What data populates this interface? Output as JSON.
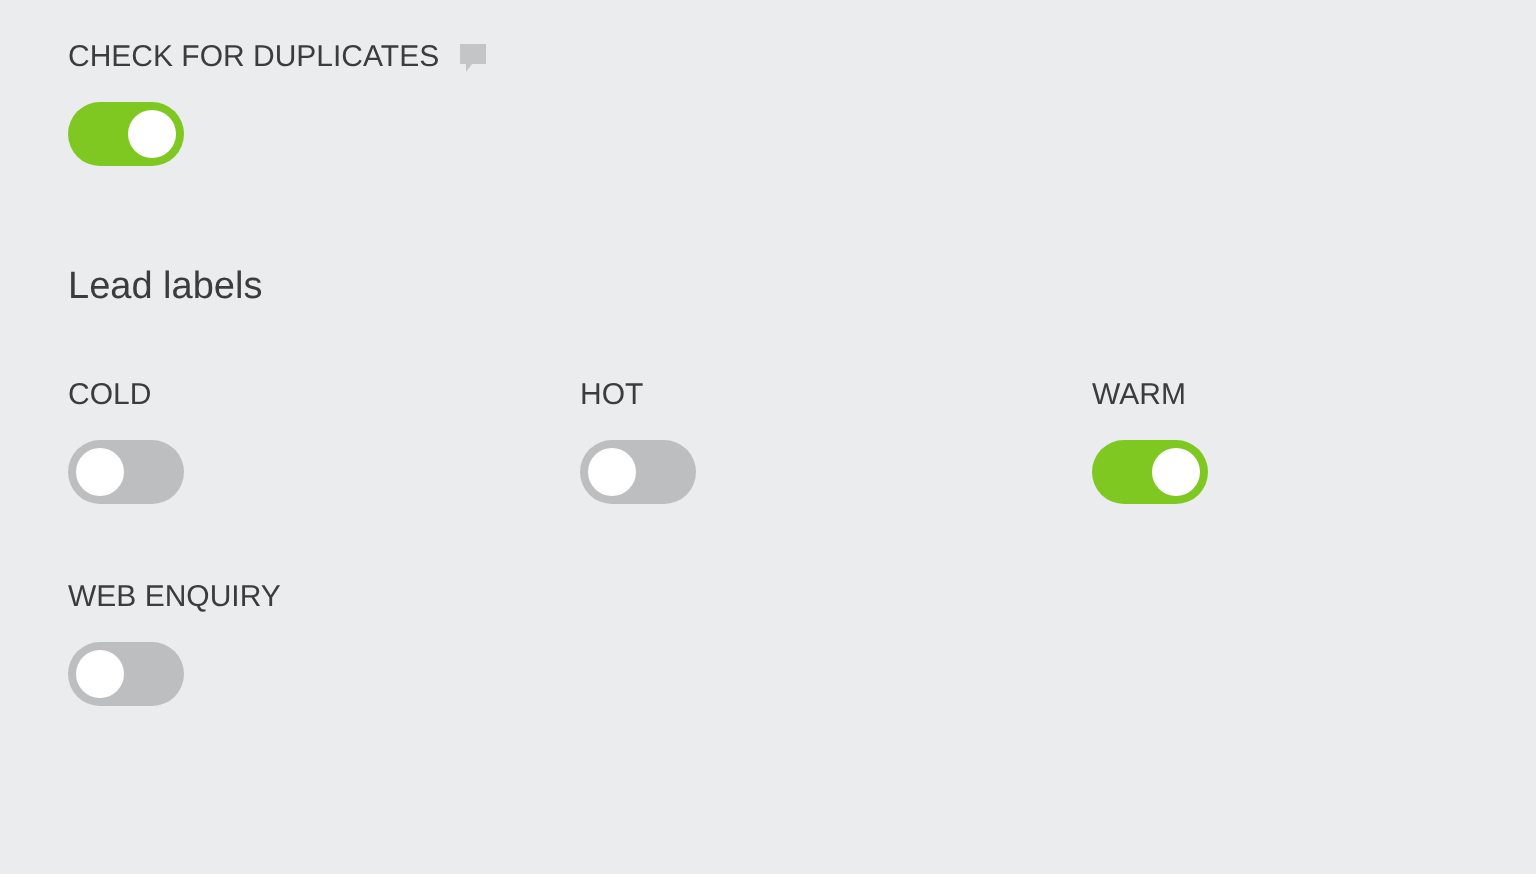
{
  "duplicates": {
    "label": "CHECK FOR DUPLICATES",
    "on": true
  },
  "lead_labels": {
    "title": "Lead labels",
    "items": [
      {
        "label": "COLD",
        "on": false
      },
      {
        "label": "HOT",
        "on": false
      },
      {
        "label": "WARM",
        "on": true
      },
      {
        "label": "WEB ENQUIRY",
        "on": false
      }
    ]
  }
}
